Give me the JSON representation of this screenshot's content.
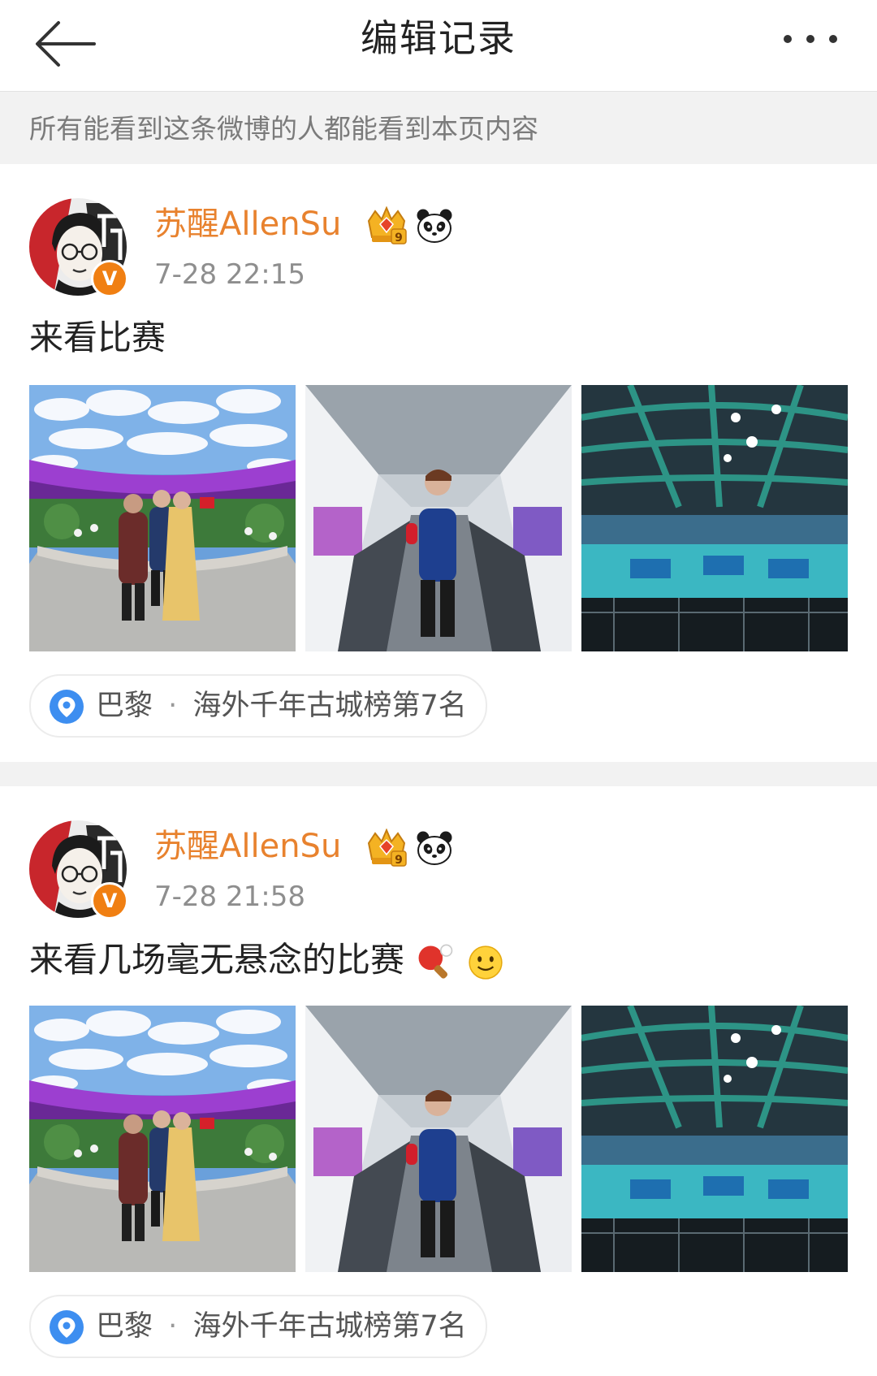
{
  "header": {
    "title": "编辑记录",
    "back_icon": "arrow-left-icon",
    "more_icon": "ellipsis-icon"
  },
  "notice": "所有能看到这条微博的人都能看到本页内容",
  "posts": [
    {
      "username": "苏醒AllenSu",
      "time": "7-28 22:15",
      "text": "来看比赛",
      "emojis": [],
      "photos": [
        "photo-group-garden",
        "photo-escalator-selfie",
        "photo-arena-wide"
      ],
      "location": {
        "city": "巴黎",
        "separator": "·",
        "detail": "海外千年古城榜第7名"
      }
    },
    {
      "username": "苏醒AllenSu",
      "time": "7-28 21:58",
      "text": "来看几场毫无悬念的比赛",
      "emojis": [
        "ping-pong-emoji",
        "smile-emoji"
      ],
      "photos": [
        "photo-group-garden",
        "photo-escalator-selfie",
        "photo-arena-wide"
      ],
      "location": {
        "city": "巴黎",
        "separator": "·",
        "detail": "海外千年古城榜第7名"
      }
    }
  ],
  "colors": {
    "username": "#e8822e",
    "verified_badge": "#f07f12",
    "location_pin": "#3d8ef0",
    "notice_bg": "#f2f2f2"
  }
}
